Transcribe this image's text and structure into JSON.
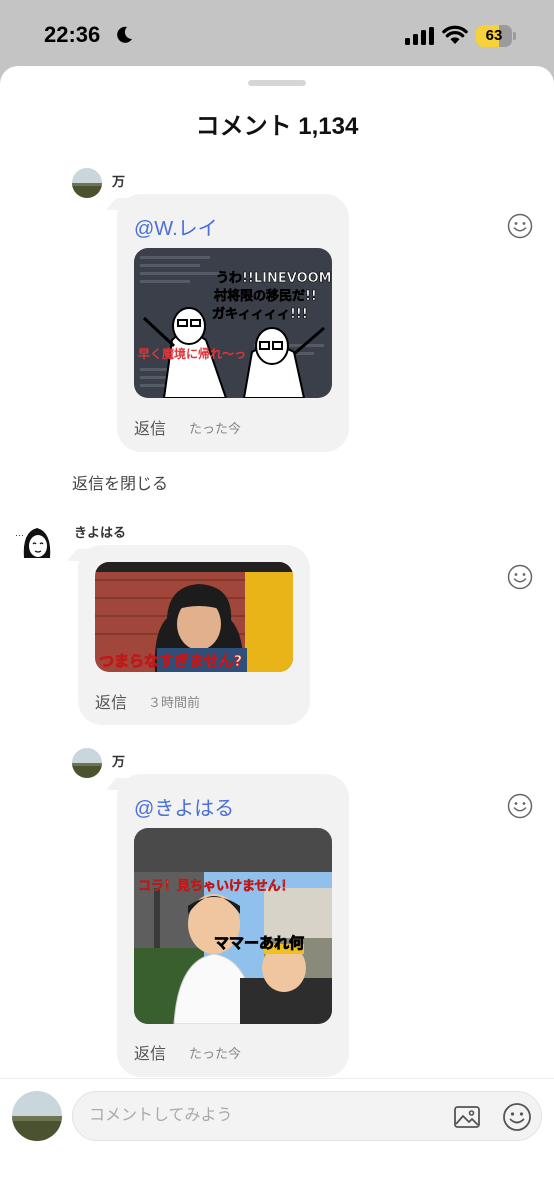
{
  "status_bar": {
    "time": "22:36",
    "battery": "63",
    "battery_level": 0.63
  },
  "sheet": {
    "title": "コメント 1,134"
  },
  "comments": [
    {
      "user": "万",
      "mention": "@W.レイ",
      "reply_label": "返信",
      "time": "たった今",
      "sticker_lines": [
        "うわ!!LINEVOOMの",
        "村将限の移民だ!!",
        "ガキィィィィ!!!"
      ],
      "sticker_caption": "早く魔境に帰れ〜っ"
    },
    {
      "user": "きよはる",
      "reply_label": "返信",
      "time": "３時間前",
      "sticker_caption": "つまらなすぎません?"
    },
    {
      "user": "万",
      "mention": "@きよはる",
      "reply_label": "返信",
      "time": "たった今",
      "sticker_caption": "コラ！見ちゃいけません！",
      "sticker_caption2": "ママーあれ何"
    }
  ],
  "close_replies": "返信を閉じる",
  "input": {
    "placeholder": "コメントしてみよう"
  },
  "icons": {
    "react": "smiley-icon",
    "image": "image-icon",
    "emoji": "emoji-icon"
  }
}
